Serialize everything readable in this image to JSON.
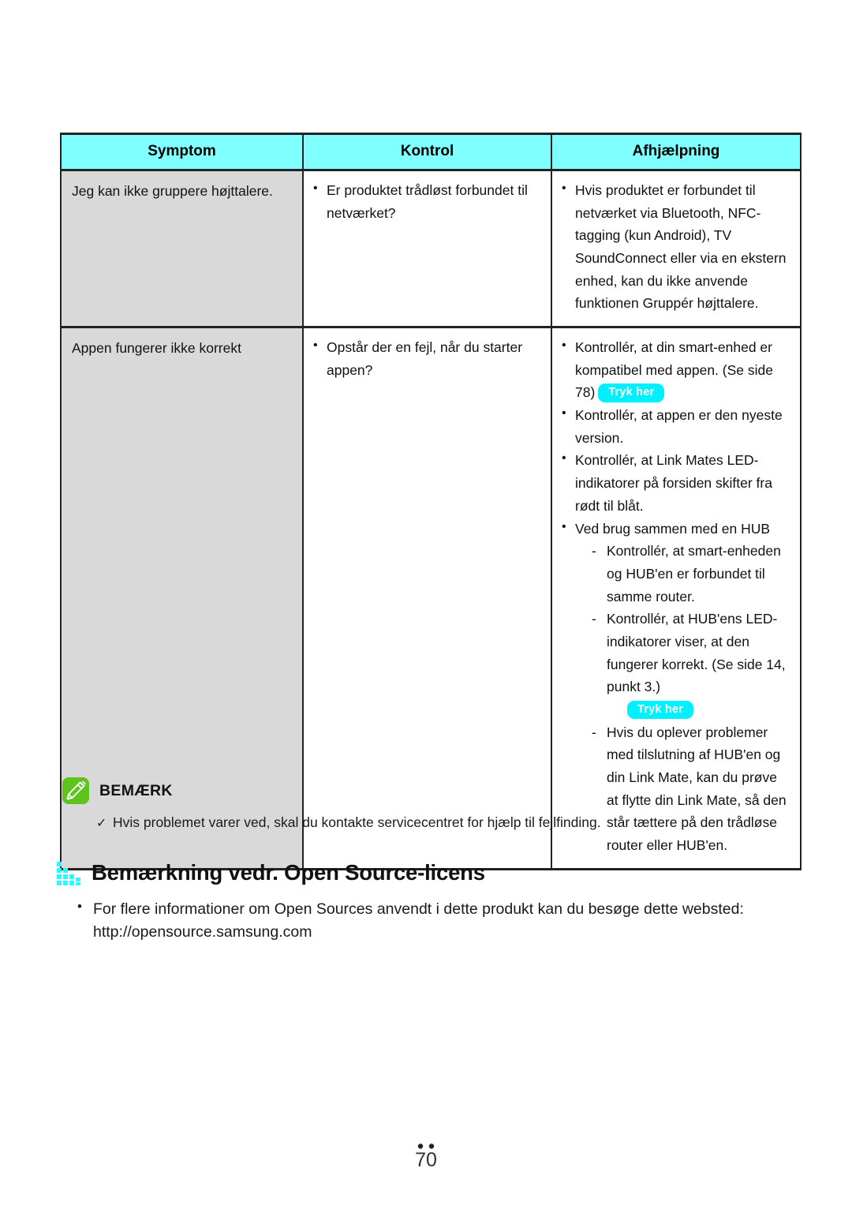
{
  "table": {
    "headers": [
      "Symptom",
      "Kontrol",
      "Afhjælpning"
    ],
    "rows": [
      {
        "symptom": "Jeg kan ikke gruppere højttalere.",
        "kontrol": [
          "Er produktet trådløst forbundet til netværket?"
        ],
        "afhjaelpning": [
          "Hvis produktet er forbundet til netværket via Bluetooth, NFC-tagging (kun Android), TV SoundConnect eller via en ekstern enhed, kan du ikke anvende funktionen Gruppér højttalere."
        ]
      },
      {
        "symptom": "Appen fungerer ikke korrekt",
        "kontrol": [
          "Opstår der en fejl, når du starter appen?"
        ],
        "a_b1_text": "Kontrollér, at din smart-enhed er kompatibel med appen. (Se side 78)",
        "a_b1_pill": "Tryk her",
        "a_b2_text": "Kontrollér, at appen er den nyeste version.",
        "a_b3_text": "Kontrollér, at Link Mates LED-indikatorer på forsiden skifter fra rødt til blåt.",
        "a_b4_text": "Ved brug sammen med en HUB",
        "a_b4_d1": "Kontrollér, at smart-enheden og HUB'en er forbundet til samme router.",
        "a_b4_d2": "Kontrollér, at HUB'ens LED-indikatorer viser, at den fungerer korrekt. (Se side 14, punkt 3.)",
        "a_b4_d2_pill": "Tryk her",
        "a_b4_d3": "Hvis du oplever problemer med tilslutning af HUB'en og din Link Mate, kan du prøve at flytte din Link Mate, så den står tættere på den trådløse router eller HUB'en."
      }
    ]
  },
  "note": {
    "title": "BEMÆRK",
    "icon": "pencil-note-icon",
    "check_mark": "✓",
    "items": [
      "Hvis problemet varer ved, skal du kontakte servicecentret for hjælp til fejlfinding."
    ]
  },
  "section": {
    "icon": "bar-steps-icon",
    "title": "Bemærkning vedr. Open Source-licens",
    "bullets": [
      "For flere informationer om Open Sources anvendt i dette produkt kan du besøge dette websted: http://opensource.samsung.com"
    ]
  },
  "footer": {
    "page_number": "70"
  },
  "colors": {
    "header_cyan": "#80ffff",
    "pill_cyan": "#00f0ff",
    "symptom_gray": "#d9d9d9",
    "note_green": "#5fc31e",
    "section_icon_cyan": "#2ff5ff"
  }
}
